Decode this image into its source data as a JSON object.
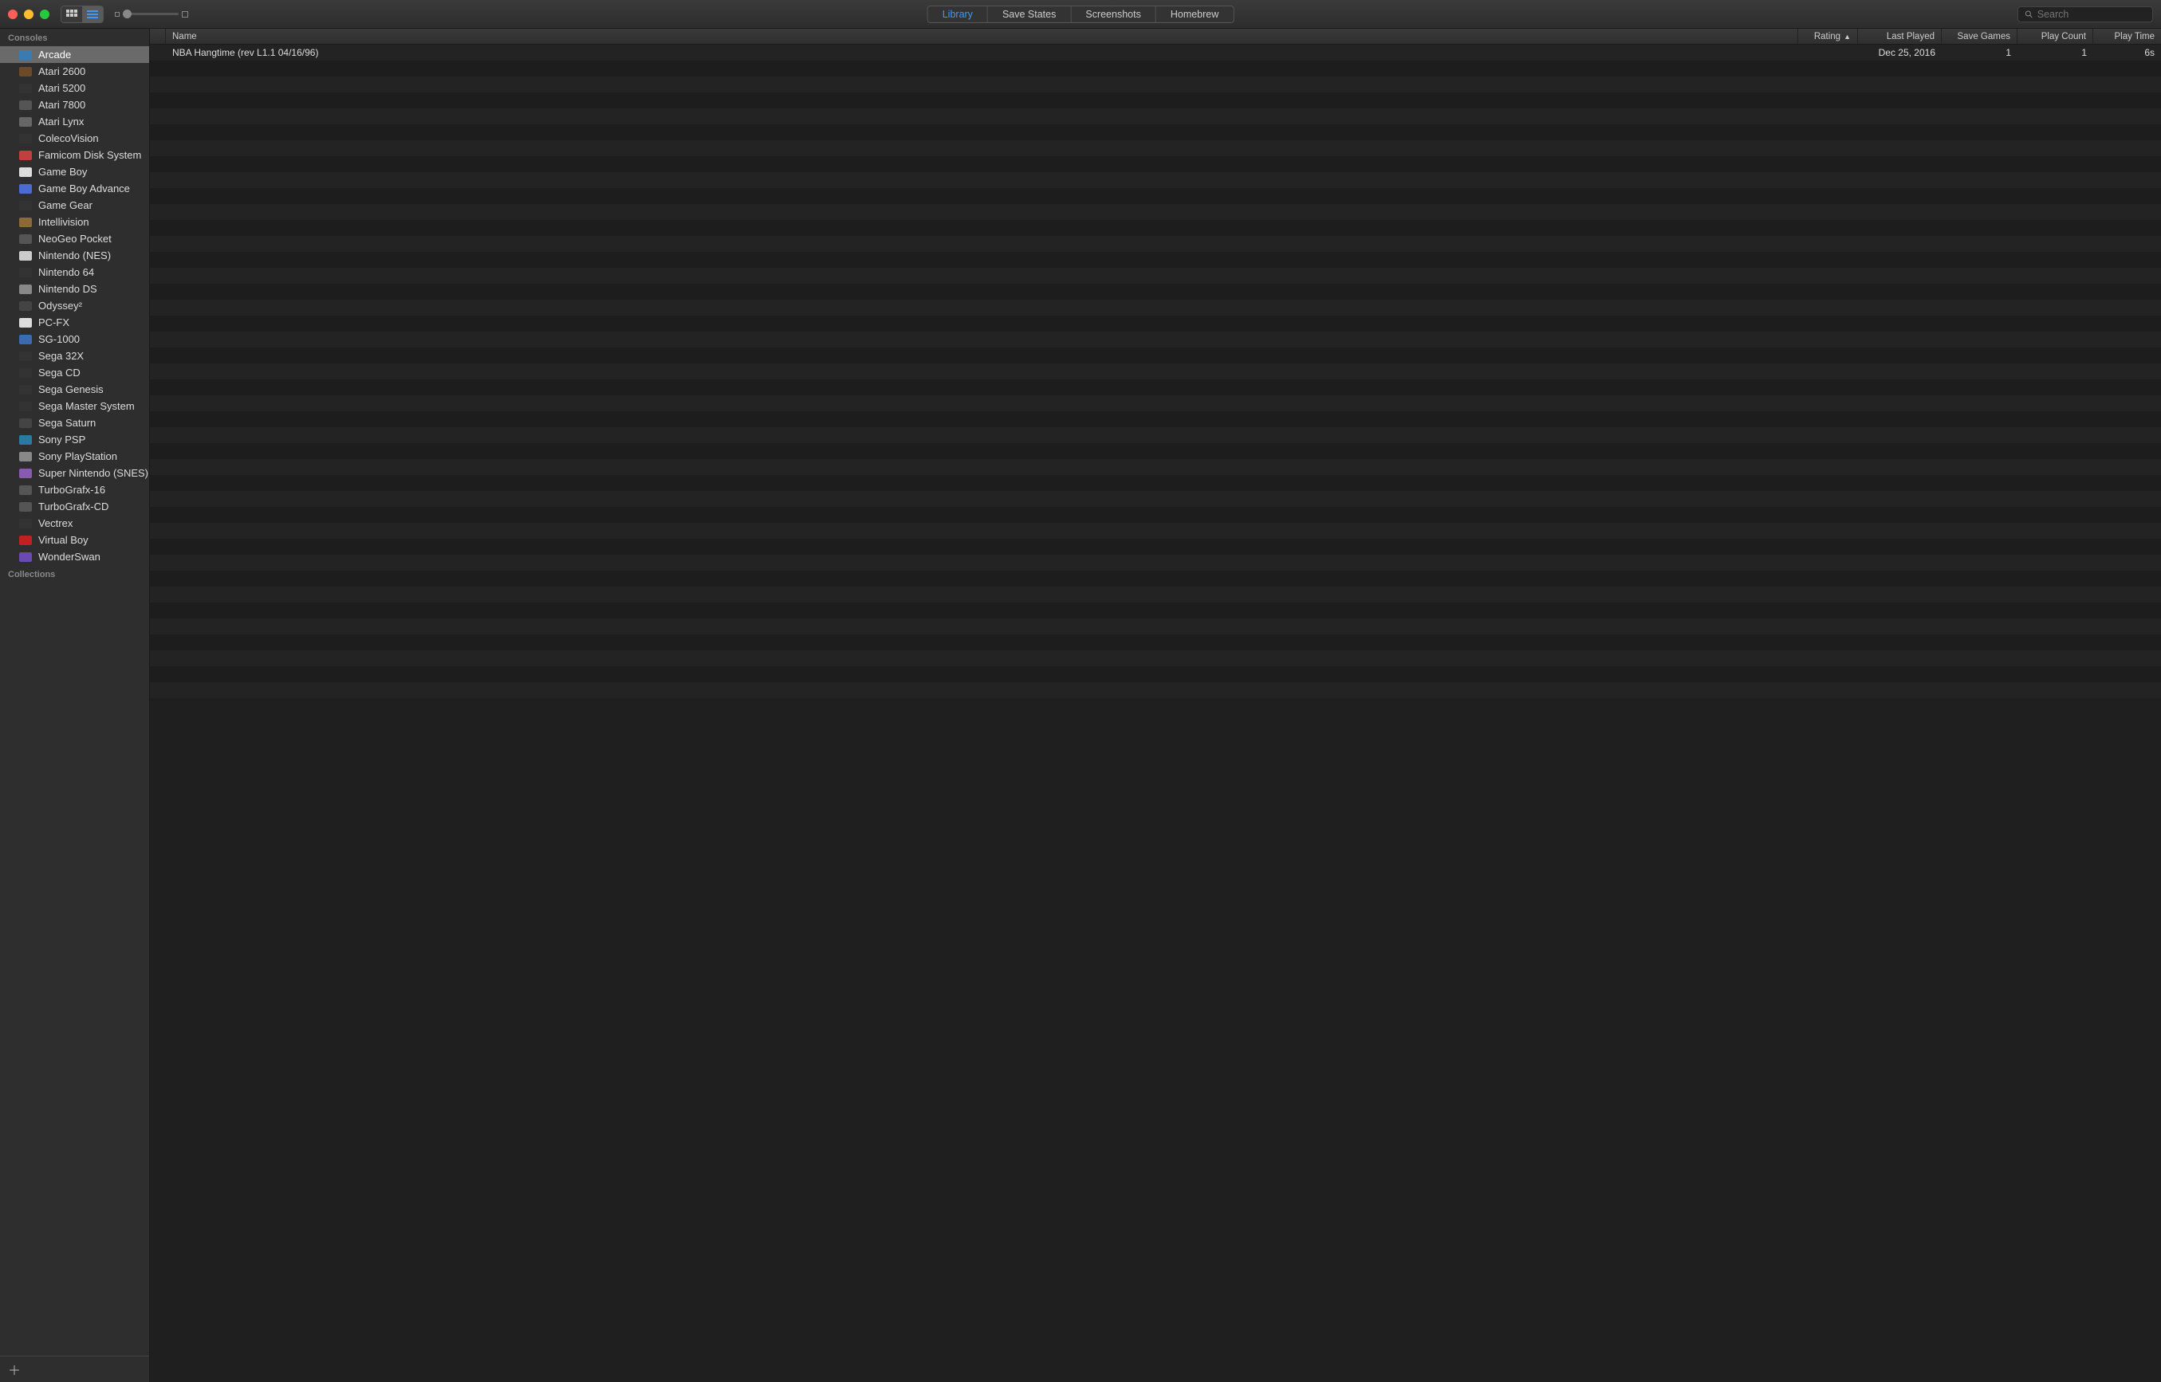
{
  "toolbar": {
    "tabs": [
      "Library",
      "Save States",
      "Screenshots",
      "Homebrew"
    ],
    "active_tab_index": 0,
    "search_placeholder": "Search",
    "view_mode": "list"
  },
  "sidebar": {
    "sections": [
      {
        "title": "Consoles",
        "items": [
          {
            "label": "Arcade",
            "icon_color": "#3b7bb0",
            "selected": true
          },
          {
            "label": "Atari 2600",
            "icon_color": "#6b4a2a"
          },
          {
            "label": "Atari 5200",
            "icon_color": "#333333"
          },
          {
            "label": "Atari 7800",
            "icon_color": "#555555"
          },
          {
            "label": "Atari Lynx",
            "icon_color": "#666666"
          },
          {
            "label": "ColecoVision",
            "icon_color": "#333333"
          },
          {
            "label": "Famicom Disk System",
            "icon_color": "#c04040"
          },
          {
            "label": "Game Boy",
            "icon_color": "#dddddd"
          },
          {
            "label": "Game Boy Advance",
            "icon_color": "#4a6bd0"
          },
          {
            "label": "Game Gear",
            "icon_color": "#333333"
          },
          {
            "label": "Intellivision",
            "icon_color": "#8a6a3a"
          },
          {
            "label": "NeoGeo Pocket",
            "icon_color": "#555555"
          },
          {
            "label": "Nintendo (NES)",
            "icon_color": "#cccccc"
          },
          {
            "label": "Nintendo 64",
            "icon_color": "#333333"
          },
          {
            "label": "Nintendo DS",
            "icon_color": "#888888"
          },
          {
            "label": "Odyssey²",
            "icon_color": "#444444"
          },
          {
            "label": "PC-FX",
            "icon_color": "#dddddd"
          },
          {
            "label": "SG-1000",
            "icon_color": "#3a6bb0"
          },
          {
            "label": "Sega 32X",
            "icon_color": "#333333"
          },
          {
            "label": "Sega CD",
            "icon_color": "#333333"
          },
          {
            "label": "Sega Genesis",
            "icon_color": "#333333"
          },
          {
            "label": "Sega Master System",
            "icon_color": "#333333"
          },
          {
            "label": "Sega Saturn",
            "icon_color": "#444444"
          },
          {
            "label": "Sony PSP",
            "icon_color": "#2a7aa0"
          },
          {
            "label": "Sony PlayStation",
            "icon_color": "#888888"
          },
          {
            "label": "Super Nintendo (SNES)",
            "icon_color": "#8a5ab0"
          },
          {
            "label": "TurboGrafx-16",
            "icon_color": "#555555"
          },
          {
            "label": "TurboGrafx-CD",
            "icon_color": "#555555"
          },
          {
            "label": "Vectrex",
            "icon_color": "#333333"
          },
          {
            "label": "Virtual Boy",
            "icon_color": "#c02020"
          },
          {
            "label": "WonderSwan",
            "icon_color": "#6a4ab0"
          }
        ]
      },
      {
        "title": "Collections",
        "items": []
      }
    ]
  },
  "table": {
    "columns": [
      {
        "key": "name",
        "label": "Name"
      },
      {
        "key": "rating",
        "label": "Rating",
        "sort": "asc"
      },
      {
        "key": "last_played",
        "label": "Last Played"
      },
      {
        "key": "save_games",
        "label": "Save Games"
      },
      {
        "key": "play_count",
        "label": "Play Count"
      },
      {
        "key": "play_time",
        "label": "Play Time"
      }
    ],
    "rows": [
      {
        "name": "NBA Hangtime (rev L1.1 04/16/96)",
        "rating": "",
        "last_played": "Dec 25, 2016",
        "save_games": "1",
        "play_count": "1",
        "play_time": "6s"
      }
    ],
    "filler_rows": 40
  }
}
